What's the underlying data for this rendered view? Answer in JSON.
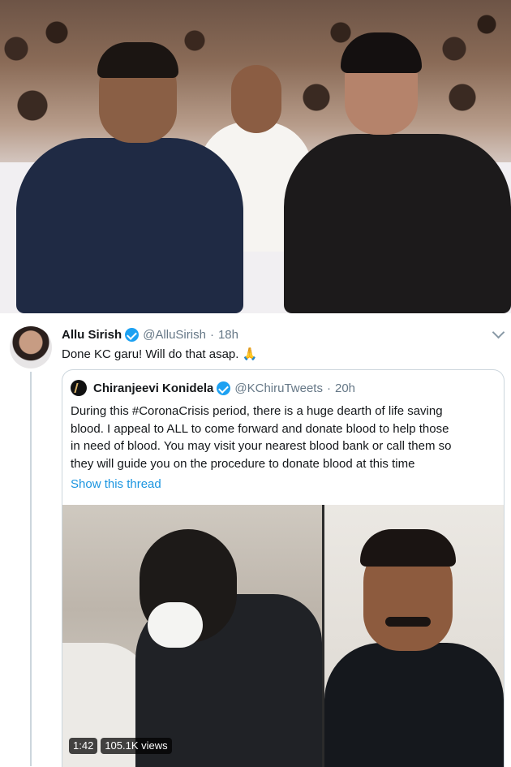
{
  "tweet": {
    "name": "Allu Sirish",
    "handle": "@AlluSirish",
    "dot": "·",
    "time": "18h",
    "text": "Done KC garu! Will do that asap.",
    "emoji": "🙏",
    "avatar_icon": "user-avatar"
  },
  "quoted": {
    "name": "Chiranjeevi Konidela",
    "handle": "@KChiruTweets",
    "dot": "·",
    "time": "20h",
    "text_lines": [
      "During this #CoronaCrisis period, there is a huge dearth of life saving",
      "blood. I appeal to ALL to come forward and donate blood to help those",
      "in need of blood. You may visit your nearest blood bank or call them so",
      "they will guide you on the procedure to donate blood at this time"
    ],
    "show_thread": "Show this thread"
  },
  "video": {
    "duration": "1:42",
    "views": "105.1K views"
  },
  "colors": {
    "link": "#1b95e0",
    "verified": "#1da1f2",
    "secondary_text": "#657786",
    "border": "#ccd6dd"
  }
}
